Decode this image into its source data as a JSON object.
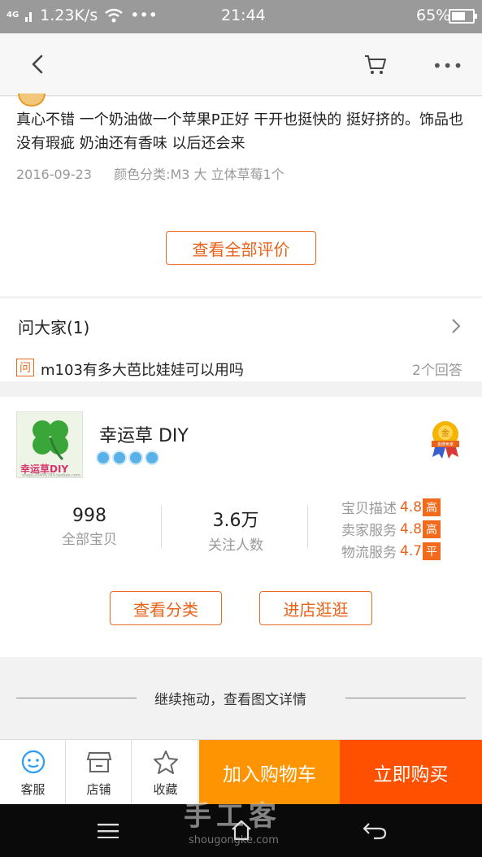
{
  "status_bar": {
    "network": "4G",
    "speed": "1.23K/s",
    "time": "21:44",
    "battery": "65%",
    "battery_level": 0.65
  },
  "nav": {
    "back_icon": "chevron-left-icon",
    "cart_icon": "cart-icon",
    "more_icon": "more-dots-icon"
  },
  "review": {
    "text": "真心不错 一个奶油做一个苹果P正好 干开也挺快的 挺好挤的。饰品也没有瑕疵 奶油还有香味 以后还会来",
    "date": "2016-09-23",
    "spec": "颜色分类:M3 大 立体草莓1个",
    "view_all_label": "查看全部评价"
  },
  "ask": {
    "title": "问大家(1)",
    "badge": "问",
    "question": "m103有多大芭比娃娃可以用吗",
    "answers": "2个回答"
  },
  "shop": {
    "name": "幸运草 DIY",
    "logo_text": "幸运草DIY",
    "logo_subtext": "shop123456789.taobao.com",
    "crown_count": 4,
    "badge_label": "金牌卖家",
    "stats": [
      {
        "value": "998",
        "label": "全部宝贝"
      },
      {
        "value": "3.6万",
        "label": "关注人数"
      }
    ],
    "ratings": [
      {
        "label": "宝贝描述",
        "score": "4.8",
        "tag": "高"
      },
      {
        "label": "卖家服务",
        "score": "4.8",
        "tag": "高"
      },
      {
        "label": "物流服务",
        "score": "4.7",
        "tag": "平"
      }
    ],
    "view_category_label": "查看分类",
    "enter_shop_label": "进店逛逛"
  },
  "drag_hint": "继续拖动，查看图文详情",
  "action_bar": {
    "service_label": "客服",
    "store_label": "店铺",
    "favorite_label": "收藏",
    "add_cart_label": "加入购物车",
    "buy_now_label": "立即购买",
    "colors": {
      "add_cart": "#ff9402",
      "buy_now": "#ff5000",
      "accent": "#e8621a"
    }
  },
  "watermark": {
    "text": "手工客",
    "sub": "shougongke.com"
  }
}
